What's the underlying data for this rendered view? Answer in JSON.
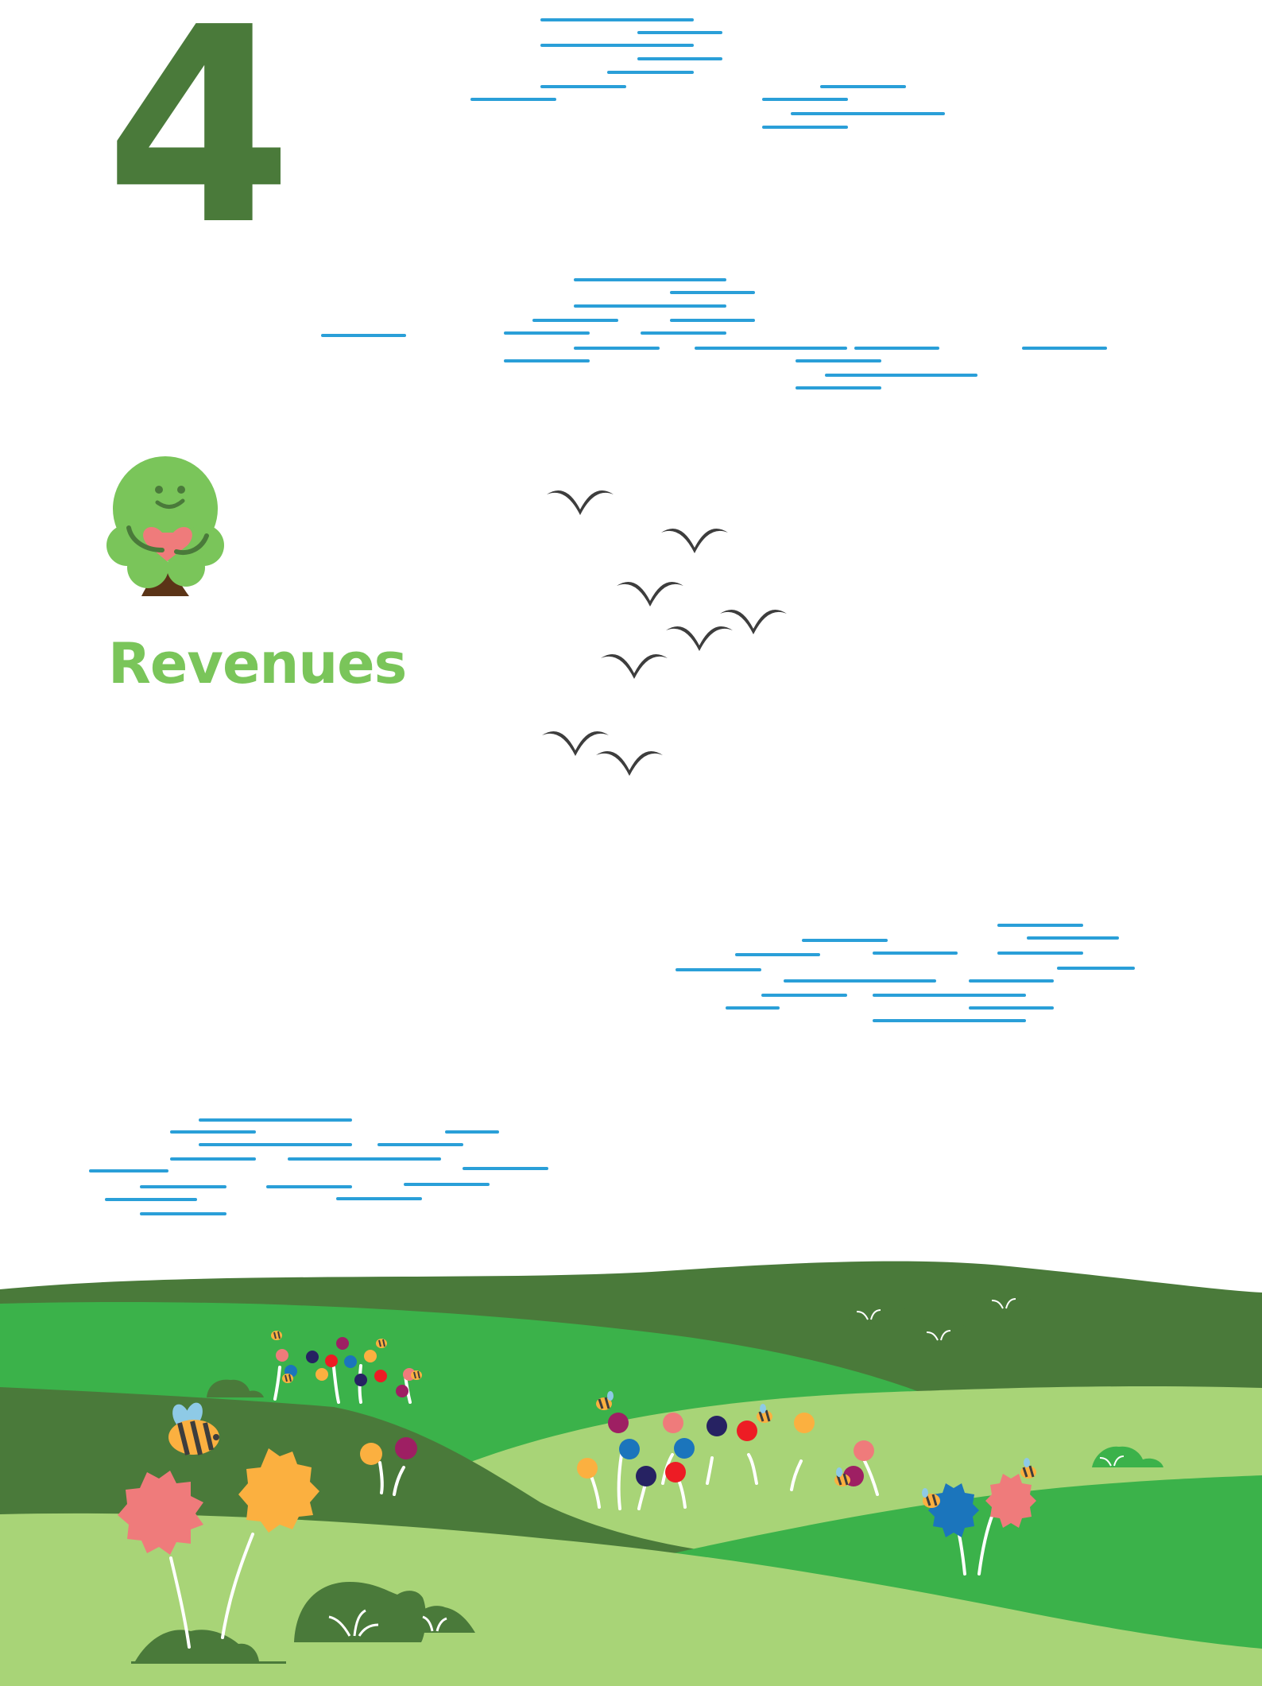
{
  "chapter": {
    "number": "4"
  },
  "section": {
    "title": "Revenues"
  },
  "icons": {
    "mascot": "tree-hugging-heart-icon",
    "birds": "bird-icon",
    "bees": "bee-icon",
    "flowers": "flower-icon",
    "bushes": "bush-icon"
  },
  "colors": {
    "chapter_number": "#4a7a3a",
    "section_title": "#7ac55a",
    "sky_lines": "#2a9fd8",
    "hill_dark": "#4a7a3a",
    "hill_mid": "#3bb24a",
    "hill_light": "#a8d477",
    "bird": "#3d3d3d"
  }
}
